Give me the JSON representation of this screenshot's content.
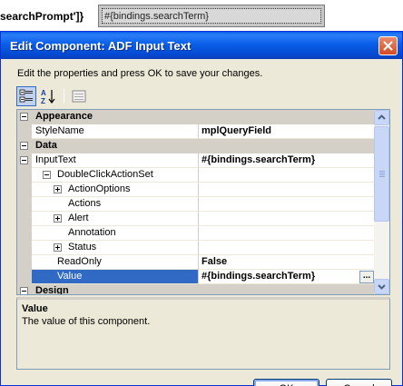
{
  "background": {
    "code_fragment": "searchPrompt']}",
    "field_value": "#{bindings.searchTerm}"
  },
  "dialog": {
    "title": "Edit Component: ADF Input Text",
    "instructions": "Edit the properties and press OK to save your changes.",
    "toolbar": {
      "categorized_icon": "categorized-view-icon",
      "alphabetical_icon": "alphabetical-sort-icon",
      "property_pages_icon": "property-pages-icon"
    },
    "grid": {
      "rows": [
        {
          "type": "category",
          "label": "Appearance",
          "expander": "minus",
          "indent": 0
        },
        {
          "type": "property",
          "label": "StyleName",
          "value": "mplQueryField",
          "indent": 0
        },
        {
          "type": "category",
          "label": "Data",
          "expander": "minus",
          "indent": 0
        },
        {
          "type": "property",
          "label": "InputText",
          "value": "#{bindings.searchTerm}",
          "expander": "minus",
          "indent": 0
        },
        {
          "type": "property",
          "label": "DoubleClickActionSet",
          "value": "",
          "expander": "minus",
          "indent": 1
        },
        {
          "type": "property",
          "label": "ActionOptions",
          "value": "",
          "expander": "plus",
          "indent": 2
        },
        {
          "type": "property",
          "label": "Actions",
          "value": "",
          "indent": 2
        },
        {
          "type": "property",
          "label": "Alert",
          "value": "",
          "expander": "plus",
          "indent": 2
        },
        {
          "type": "property",
          "label": "Annotation",
          "value": "",
          "indent": 2
        },
        {
          "type": "property",
          "label": "Status",
          "value": "",
          "expander": "plus",
          "indent": 2
        },
        {
          "type": "property",
          "label": "ReadOnly",
          "value": "False",
          "indent": 1
        },
        {
          "type": "property",
          "label": "Value",
          "value": "#{bindings.searchTerm}",
          "indent": 1,
          "selected": true
        },
        {
          "type": "category",
          "label": "Design",
          "expander": "minus",
          "indent": 0
        }
      ],
      "ellipsis": "..."
    },
    "description": {
      "title": "Value",
      "text": "The value of this component."
    },
    "buttons": {
      "ok": "OK",
      "cancel": "Cancel"
    }
  },
  "colors": {
    "titlebar": "#0a5fe8",
    "selection": "#316ac5",
    "dialog_bg": "#ece9d8",
    "category_bg": "#d4d0c8"
  }
}
